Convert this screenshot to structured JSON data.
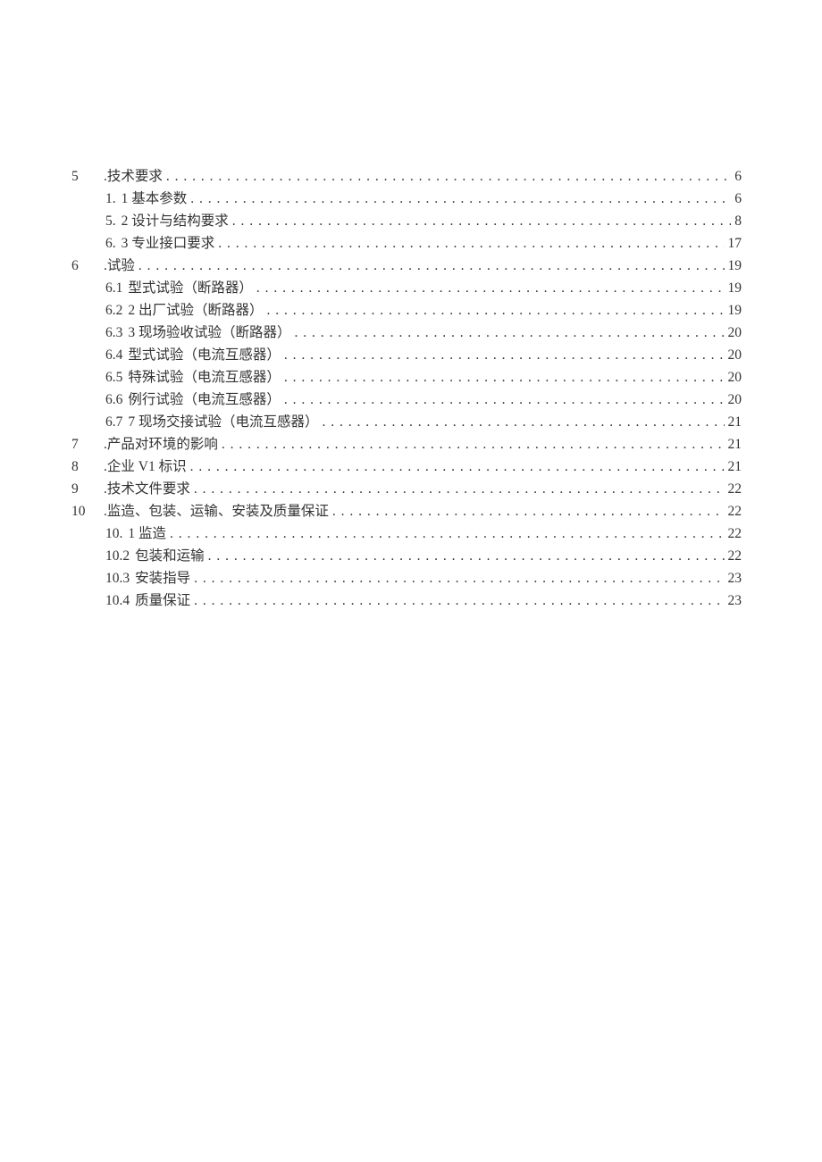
{
  "toc": [
    {
      "level": 0,
      "num": "5",
      "label": ".技术要求",
      "page": "6"
    },
    {
      "level": 1,
      "num": "1.",
      "label": "1 基本参数",
      "page": "6"
    },
    {
      "level": 1,
      "num": "5.",
      "label": "2 设计与结构要求",
      "page": "8"
    },
    {
      "level": 1,
      "num": "6.",
      "label": "3 专业接口要求",
      "page": "17"
    },
    {
      "level": 0,
      "num": "6",
      "label": ".试验",
      "page": "19"
    },
    {
      "level": 1,
      "num": "6.1",
      "label": "型式试验（断路器）",
      "page": "19"
    },
    {
      "level": 1,
      "num": "6.2",
      "label": "2 出厂试验（断路器）",
      "page": "19"
    },
    {
      "level": 1,
      "num": "6.3",
      "label": "3 现场验收试验（断路器）",
      "page": "20"
    },
    {
      "level": 1,
      "num": "6.4",
      "label": "型式试验（电流互感器）",
      "page": "20"
    },
    {
      "level": 1,
      "num": "6.5",
      "label": "特殊试验（电流互感器）",
      "page": "20"
    },
    {
      "level": 1,
      "num": "6.6",
      "label": "例行试验（电流互感器）",
      "page": "20"
    },
    {
      "level": 1,
      "num": "6.7",
      "label": "7 现场交接试验（电流互感器）",
      "page": "21"
    },
    {
      "level": 0,
      "num": "7",
      "label": ".产品对环境的影响",
      "page": "21"
    },
    {
      "level": 0,
      "num": "8",
      "label": ".企业 V1 标识",
      "page": "21"
    },
    {
      "level": 0,
      "num": "9",
      "label": ".技术文件要求",
      "page": "22"
    },
    {
      "level": 0,
      "num": "10",
      "label": ".监造、包装、运输、安装及质量保证",
      "page": "22"
    },
    {
      "level": 1,
      "num": "10.",
      "label": "1 监造",
      "page": "22"
    },
    {
      "level": 1,
      "num": "10.2",
      "label": "包装和运输",
      "page": "22"
    },
    {
      "level": 1,
      "num": "10.3",
      "label": "安装指导",
      "page": "23"
    },
    {
      "level": 1,
      "num": "10.4",
      "label": "质量保证",
      "page": "23"
    }
  ]
}
